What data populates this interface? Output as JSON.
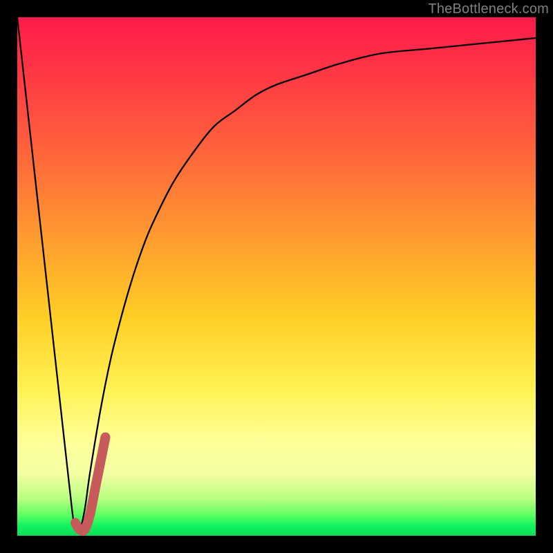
{
  "watermark": {
    "text": "TheBottleneck.com"
  },
  "chart_data": {
    "type": "line",
    "title": "",
    "xlabel": "",
    "ylabel": "",
    "xlim": [
      0,
      100
    ],
    "ylim": [
      0,
      100
    ],
    "grid": false,
    "legend": false,
    "series": [
      {
        "name": "bottleneck-curve",
        "color": "#000000",
        "x": [
          0,
          2,
          4,
          6,
          8,
          10,
          11,
          12,
          13,
          14,
          16,
          18,
          20,
          22,
          24,
          26,
          30,
          34,
          38,
          42,
          46,
          50,
          56,
          62,
          70,
          80,
          90,
          100
        ],
        "y": [
          100,
          82,
          64,
          46,
          28,
          10,
          2,
          1,
          5,
          12,
          24,
          34,
          42,
          49,
          55,
          60,
          68,
          74,
          79,
          82,
          85,
          87,
          89,
          91,
          93,
          94,
          95,
          96
        ]
      },
      {
        "name": "highlight-j-marker",
        "color": "#c75a5a",
        "x": [
          11.2,
          12.0,
          13.0,
          14.0,
          15.0,
          16.0,
          17.0
        ],
        "y": [
          2.5,
          1.2,
          1.2,
          4.0,
          9.0,
          14.0,
          19.0
        ]
      }
    ],
    "background_gradient": {
      "direction": "vertical",
      "stops": [
        {
          "pos": 0.0,
          "color": "#ff1a49"
        },
        {
          "pos": 0.28,
          "color": "#ff6a3a"
        },
        {
          "pos": 0.58,
          "color": "#ffcf25"
        },
        {
          "pos": 0.82,
          "color": "#ffff9a"
        },
        {
          "pos": 0.96,
          "color": "#5eff62"
        },
        {
          "pos": 1.0,
          "color": "#0bdc5b"
        }
      ]
    }
  }
}
